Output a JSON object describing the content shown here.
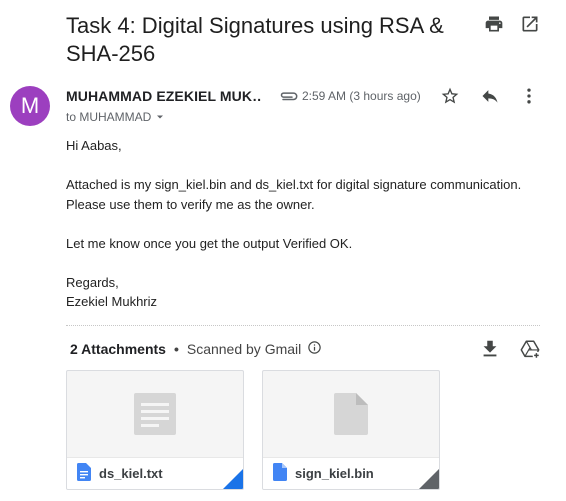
{
  "email": {
    "subject": "Task 4: Digital Signatures using RSA & SHA-256",
    "sender": {
      "initial": "M",
      "name": "MUHAMMAD EZEKIEL MUK…",
      "avatar_color": "#9c3fbf"
    },
    "time": "2:59 AM (3 hours ago)",
    "to_label": "to MUHAMMAD",
    "body": [
      "Hi Aabas,",
      "",
      "Attached is my sign_kiel.bin and ds_kiel.txt for digital signature communication.",
      "Please use them to verify me as the owner.",
      "",
      "Let me know once you get the output Verified OK.",
      "",
      "Regards,",
      "Ezekiel Mukhriz"
    ]
  },
  "toolbar_icons": [
    "print-icon",
    "open-in-new-icon",
    "star-icon",
    "reply-icon",
    "more-vert-icon",
    "paperclip-icon"
  ],
  "attachments": {
    "count_label": "2 Attachments",
    "separator": "•",
    "scan_label": "Scanned by Gmail",
    "action_icons": [
      "download-icon",
      "add-to-drive-icon"
    ],
    "files": [
      {
        "name": "ds_kiel.txt",
        "type": "text",
        "corner_color": "#1a73e8"
      },
      {
        "name": "sign_kiel.bin",
        "type": "binary",
        "corner_color": "#5f6368"
      }
    ]
  },
  "colors": {
    "file_icon_blue": "#4285f4",
    "icon_gray": "#444746",
    "muted_text": "#5f6368"
  }
}
